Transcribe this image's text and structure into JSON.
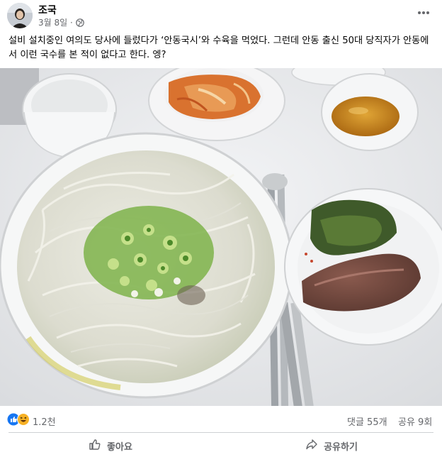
{
  "post": {
    "author": "조국",
    "date": "3월 8일 ·",
    "body": "설비 설치중인 여의도 당사에 들렀다가 ‘안동국시’와 수육을 먹었다. 그런데 안동 출신 50대 당직자가 안동에서 이런 국수를 본 적이 없다고 한다. 엥?",
    "photo_icon": "noodle-soup-photo",
    "privacy_icon": "globe-icon",
    "menu_icon": "more-horizontal-icon"
  },
  "stats": {
    "reaction_count": "1.2천",
    "comments": "댓글 55개",
    "shares": "공유 9회",
    "reaction_icons": [
      "like-reaction-icon",
      "haha-reaction-icon"
    ]
  },
  "actions": {
    "like": "좋아요",
    "share": "공유하기"
  },
  "colors": {
    "like_blue": "#1877f2",
    "haha_yellow": "#f7b125",
    "muted_text": "#65676b",
    "divider": "#ced0d4"
  }
}
